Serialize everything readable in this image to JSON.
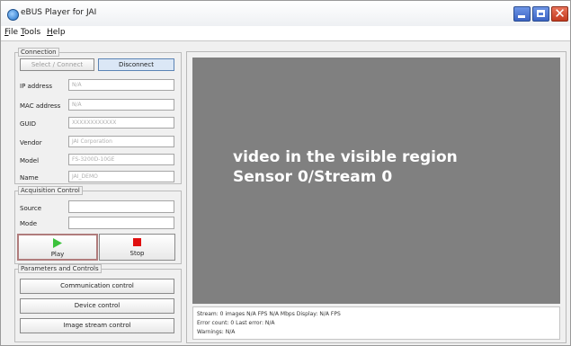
{
  "window": {
    "title": "eBUS Player for JAI",
    "icon": "app-icon",
    "controls": [
      "minimize",
      "maximize",
      "close"
    ],
    "close_glyph": "✕"
  },
  "menubar": {
    "items": [
      "File",
      "Tools",
      "Help"
    ]
  },
  "connection": {
    "title": "Connection",
    "select_connect_label": "Select / Connect",
    "disconnect_label": "Disconnect",
    "fields": [
      {
        "label": "IP address",
        "value": "N/A"
      },
      {
        "label": "MAC address",
        "value": "N/A"
      },
      {
        "label": "GUID",
        "value": "XXXXXXXXXXXX"
      },
      {
        "label": "Vendor",
        "value": "JAI Corporation"
      },
      {
        "label": "Model",
        "value": "FS-3200D-10GE"
      },
      {
        "label": "Name",
        "value": "JAI_DEMO"
      }
    ]
  },
  "acquisition": {
    "title": "Acquisition Control",
    "source_label": "Source",
    "source_value": "",
    "mode_label": "Mode",
    "mode_value": "",
    "play_label": "Play",
    "stop_label": "Stop",
    "play_color": "#3cc23c",
    "stop_color": "#e01010"
  },
  "parameters": {
    "title": "Parameters and Controls",
    "buttons": [
      "Communication control",
      "Device control",
      "Image stream control"
    ]
  },
  "display": {
    "overlay_line1": "video in the visible region",
    "overlay_line2": "Sensor 0/Stream 0",
    "background": "#808080"
  },
  "status": {
    "line1": "Stream: 0 images   N/A FPS    N/A Mbps   Display: N/A FPS",
    "line2": "Error count: 0   Last error: N/A",
    "line3": "Warnings: N/A"
  }
}
